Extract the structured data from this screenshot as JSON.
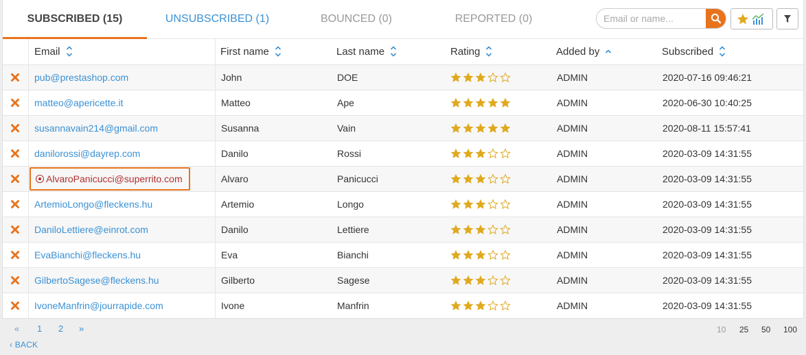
{
  "tabs": [
    {
      "label": "SUBSCRIBED (15)"
    },
    {
      "label": "UNSUBSCRIBED (1)"
    },
    {
      "label": "BOUNCED (0)"
    },
    {
      "label": "REPORTED (0)"
    }
  ],
  "search": {
    "placeholder": "Email or name..."
  },
  "icons": {
    "search": "search-icon",
    "rating_stats": "star-chart-icon",
    "filter": "filter-icon",
    "delete": "close-x-icon"
  },
  "colors": {
    "accent": "#e8731c",
    "link": "#3a91d4",
    "star": "#e0a91e",
    "highlight_text": "#b03030"
  },
  "columns": [
    "Email",
    "First name",
    "Last name",
    "Rating",
    "Added by",
    "Subscribed"
  ],
  "rows": [
    {
      "email": "pub@prestashop.com",
      "first": "John",
      "last": "DOE",
      "rating": 3,
      "added_by": "ADMIN",
      "subscribed": "2020-07-16 09:46:21"
    },
    {
      "email": "matteo@apericette.it",
      "first": "Matteo",
      "last": "Ape",
      "rating": 5,
      "added_by": "ADMIN",
      "subscribed": "2020-06-30 10:40:25"
    },
    {
      "email": "susannavain214@gmail.com",
      "first": "Susanna",
      "last": "Vain",
      "rating": 5,
      "added_by": "ADMIN",
      "subscribed": "2020-08-11 15:57:41"
    },
    {
      "email": "danilorossi@dayrep.com",
      "first": "Danilo",
      "last": "Rossi",
      "rating": 3,
      "added_by": "ADMIN",
      "subscribed": "2020-03-09 14:31:55"
    },
    {
      "email": "AlvaroPanicucci@superrito.com",
      "first": "Alvaro",
      "last": "Panicucci",
      "rating": 3,
      "added_by": "ADMIN",
      "subscribed": "2020-03-09 14:31:55",
      "highlighted": true
    },
    {
      "email": "ArtemioLongo@fleckens.hu",
      "first": "Artemio",
      "last": "Longo",
      "rating": 3,
      "added_by": "ADMIN",
      "subscribed": "2020-03-09 14:31:55"
    },
    {
      "email": "DaniloLettiere@einrot.com",
      "first": "Danilo",
      "last": "Lettiere",
      "rating": 3,
      "added_by": "ADMIN",
      "subscribed": "2020-03-09 14:31:55"
    },
    {
      "email": "EvaBianchi@fleckens.hu",
      "first": "Eva",
      "last": "Bianchi",
      "rating": 3,
      "added_by": "ADMIN",
      "subscribed": "2020-03-09 14:31:55"
    },
    {
      "email": "GilbertoSagese@fleckens.hu",
      "first": "Gilberto",
      "last": "Sagese",
      "rating": 3,
      "added_by": "ADMIN",
      "subscribed": "2020-03-09 14:31:55"
    },
    {
      "email": "IvoneManfrin@jourrapide.com",
      "first": "Ivone",
      "last": "Manfrin",
      "rating": 3,
      "added_by": "ADMIN",
      "subscribed": "2020-03-09 14:31:55"
    }
  ],
  "pagination": {
    "prev": "«",
    "pages": [
      "1",
      "2"
    ],
    "next": "»"
  },
  "per_page": {
    "options": [
      "10",
      "25",
      "50",
      "100"
    ],
    "selected": "10"
  },
  "back_label": "‹ BACK"
}
